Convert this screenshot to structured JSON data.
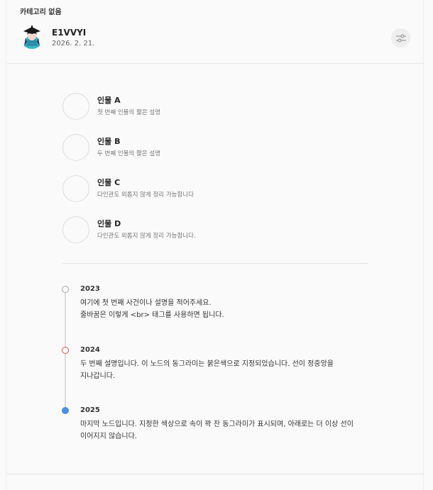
{
  "post": {
    "category": "카테고리 없음",
    "author": "E1VVYI",
    "date": "2026. 2. 21."
  },
  "icons": {
    "settings": "sliders-icon"
  },
  "people": [
    {
      "name": "인물 A",
      "desc": "첫 번째 인물의 짧은 설명"
    },
    {
      "name": "인물 B",
      "desc": "두 번째 인물의 짧은 설명"
    },
    {
      "name": "인물 C",
      "desc": "다인관도 외롭지 않게 정리 가능합니다"
    },
    {
      "name": "인물 D",
      "desc": "다인관도 외롭지 않게 정리 가능합니다."
    }
  ],
  "timeline": [
    {
      "year": "2023",
      "lines": [
        "여기에 첫 번째 사건이나 설명을 적어주세요.",
        "줄바꿈은 이렇게 <br> 태그를 사용하면 됩니다."
      ],
      "dot_style": "outline",
      "dot_color": "#aaaaaa"
    },
    {
      "year": "2024",
      "lines": [
        "두 번째 설명입니다. 이 노드의 동그라미는 붉은색으로 지정되었습니다. 선이 정중앙을",
        "지나갑니다."
      ],
      "dot_style": "outline",
      "dot_color": "#d9534f"
    },
    {
      "year": "2025",
      "lines": [
        "마지막 노드입니다. 지정한 색상으로 속이 꽉 찬 동그라미가 표시되며, 아래로는 더 이상 선이",
        "이어지지 않습니다."
      ],
      "dot_style": "filled",
      "dot_color": "#4a90e2"
    }
  ]
}
